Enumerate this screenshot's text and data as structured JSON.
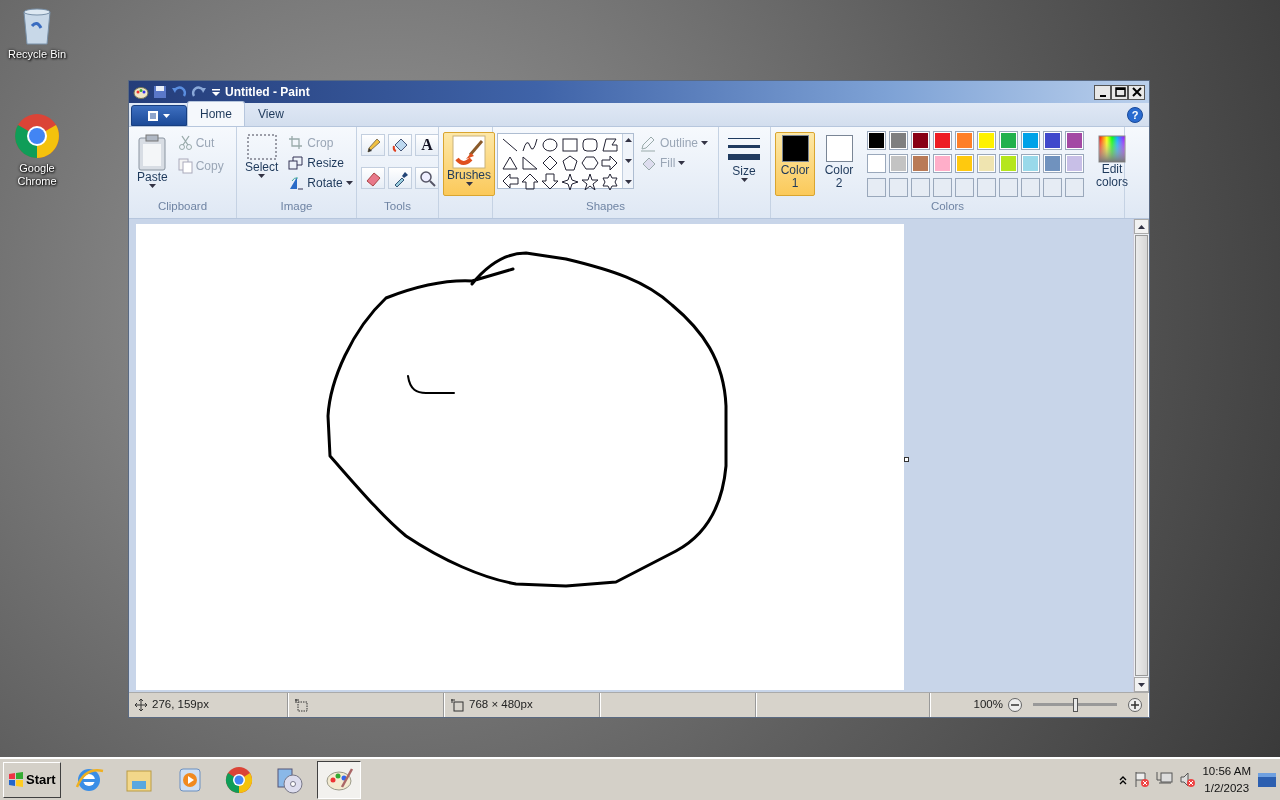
{
  "desktop_icons": [
    {
      "kind": "bin",
      "label": "Recycle Bin"
    },
    {
      "kind": "chrome",
      "label": "Google Chrome"
    }
  ],
  "window": {
    "title": "Untitled - Paint",
    "help": "?"
  },
  "tabs": [
    {
      "label": "Home",
      "selected": true
    },
    {
      "label": "View",
      "selected": false
    }
  ],
  "clipboard": {
    "label": "Clipboard",
    "paste": "Paste",
    "actions": [
      {
        "kind": "cut",
        "label": "Cut",
        "disabled": true
      },
      {
        "kind": "copy",
        "label": "Copy",
        "disabled": true
      }
    ]
  },
  "image": {
    "label": "Image",
    "select": "Select",
    "actions": [
      {
        "kind": "crop",
        "label": "Crop",
        "disabled": true,
        "dropdown": false
      },
      {
        "kind": "resize",
        "label": "Resize",
        "disabled": false,
        "dropdown": false
      },
      {
        "kind": "rotate",
        "label": "Rotate",
        "disabled": false,
        "dropdown": true
      }
    ]
  },
  "tools": {
    "label": "Tools",
    "text_tool": "A"
  },
  "brushes": {
    "label": "Brushes",
    "selected": true
  },
  "shapes": {
    "label": "Shapes",
    "options": [
      {
        "kind": "outline",
        "label": "Outline",
        "disabled": true
      },
      {
        "kind": "fill",
        "label": "Fill",
        "disabled": true
      }
    ]
  },
  "size": {
    "label": "Size"
  },
  "colors": {
    "label": "Colors",
    "slots": [
      {
        "label": "Color 1",
        "color": "#000000",
        "selected": true
      },
      {
        "label": "Color 2",
        "color": "#ffffff",
        "selected": false
      }
    ],
    "palette": [
      {
        "color": "#000000"
      },
      {
        "color": "#7f7f7f"
      },
      {
        "color": "#880015"
      },
      {
        "color": "#ed1c24"
      },
      {
        "color": "#ff7f27"
      },
      {
        "color": "#fff200"
      },
      {
        "color": "#22b14c"
      },
      {
        "color": "#00a2e8"
      },
      {
        "color": "#3f48cc"
      },
      {
        "color": "#a349a4"
      },
      {
        "color": "#ffffff"
      },
      {
        "color": "#c3c3c3"
      },
      {
        "color": "#b97a57"
      },
      {
        "color": "#ffaec9"
      },
      {
        "color": "#ffc90e"
      },
      {
        "color": "#efe4b0"
      },
      {
        "color": "#b5e61d"
      },
      {
        "color": "#99d9ea"
      },
      {
        "color": "#7092be"
      },
      {
        "color": "#c8bfe7"
      }
    ],
    "edit": "Edit colors"
  },
  "status_bar": {
    "cursor": "276, 159px",
    "canvas_size": "768 × 480px",
    "zoom": "100%",
    "zoom_slider": {
      "level": 0.5
    }
  },
  "taskbar": {
    "start": "Start",
    "apps": [
      {
        "kind": "ie",
        "selected": false
      },
      {
        "kind": "explorer",
        "selected": false
      },
      {
        "kind": "media",
        "selected": false
      },
      {
        "kind": "chrome",
        "selected": false
      },
      {
        "kind": "installer",
        "selected": false
      },
      {
        "kind": "paint",
        "selected": true
      }
    ],
    "time": "10:56 AM",
    "date": "1/2/2023"
  }
}
